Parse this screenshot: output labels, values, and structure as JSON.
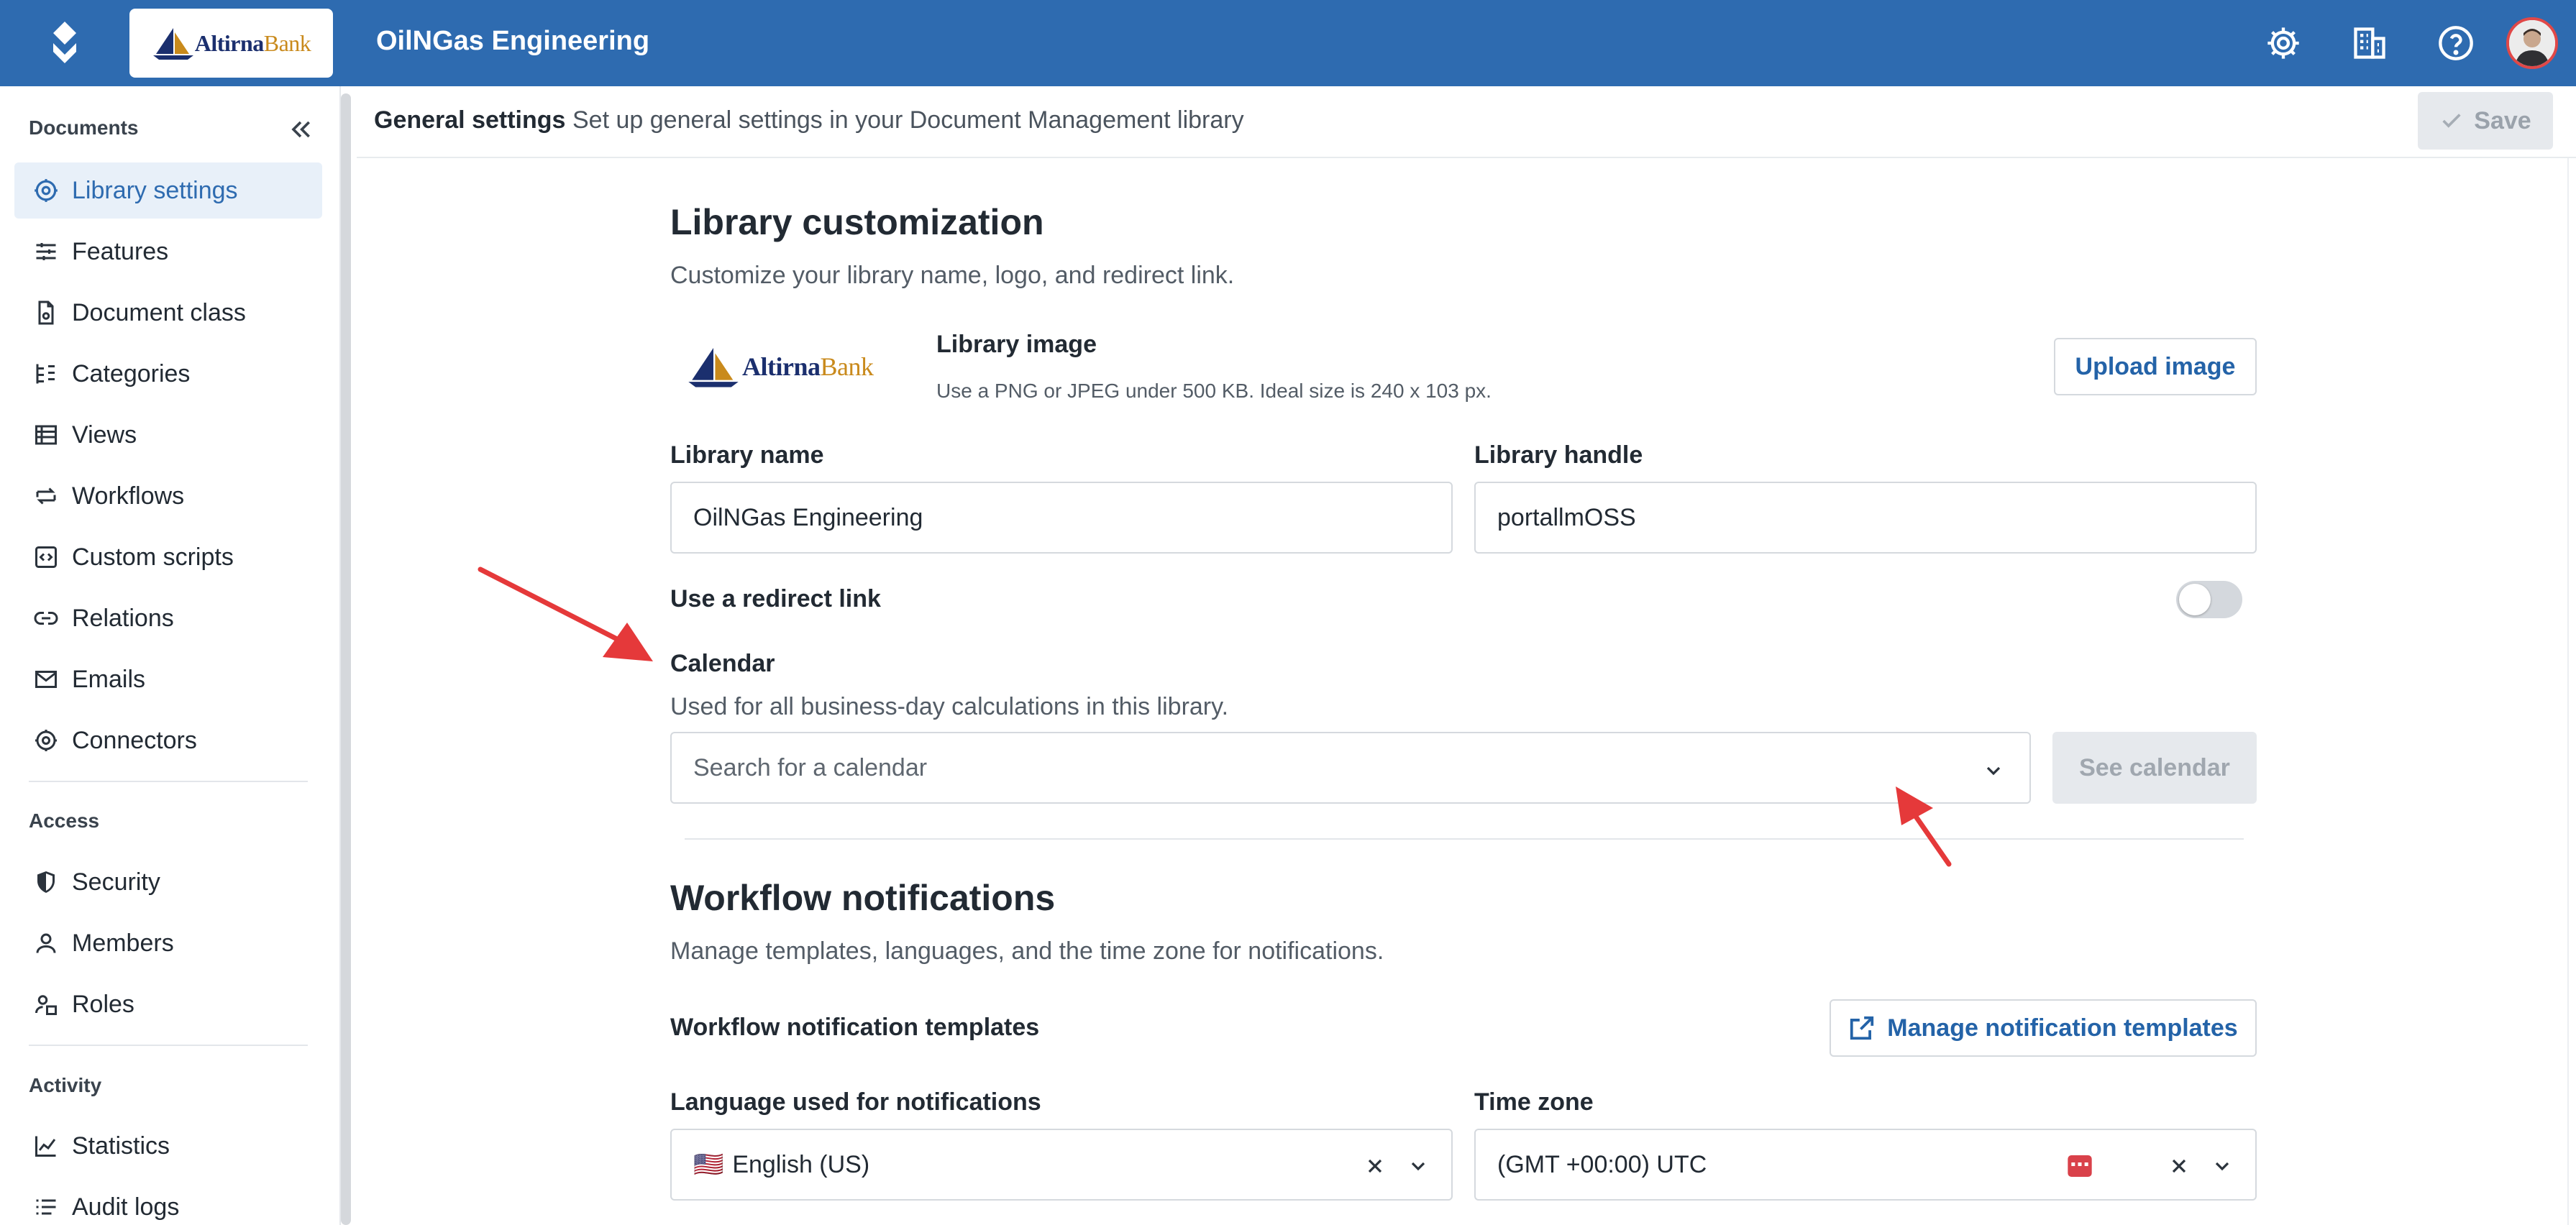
{
  "header": {
    "brand_part1": "Altirna",
    "brand_part2": "Bank",
    "title": "OilNGas Engineering",
    "icons": [
      "settings-icon",
      "building-icon",
      "help-icon"
    ]
  },
  "sidebar": {
    "sections": {
      "documents": "Documents",
      "access": "Access",
      "activity": "Activity"
    },
    "documents_items": [
      {
        "label": "Library settings",
        "icon": "gear-icon"
      },
      {
        "label": "Features",
        "icon": "sliders-icon"
      },
      {
        "label": "Document class",
        "icon": "file-gear-icon"
      },
      {
        "label": "Categories",
        "icon": "tree-icon"
      },
      {
        "label": "Views",
        "icon": "table-icon"
      },
      {
        "label": "Workflows",
        "icon": "loop-icon"
      },
      {
        "label": "Custom scripts",
        "icon": "code-icon"
      },
      {
        "label": "Relations",
        "icon": "link-icon"
      },
      {
        "label": "Emails",
        "icon": "mail-icon"
      },
      {
        "label": "Connectors",
        "icon": "gear-icon"
      }
    ],
    "access_items": [
      {
        "label": "Security",
        "icon": "shield-icon"
      },
      {
        "label": "Members",
        "icon": "person-icon"
      },
      {
        "label": "Roles",
        "icon": "roles-icon"
      }
    ],
    "activity_items": [
      {
        "label": "Statistics",
        "icon": "chart-icon"
      },
      {
        "label": "Audit logs",
        "icon": "list-icon"
      }
    ]
  },
  "settings_bar": {
    "title": "General settings",
    "subtitle": "Set up general settings in your Document Management library",
    "save_label": "Save"
  },
  "customization": {
    "heading": "Library customization",
    "description": "Customize your library name, logo, and redirect link.",
    "image_label": "Library image",
    "image_hint": "Use a PNG or JPEG under 500 KB. Ideal size is 240 x 103 px.",
    "upload_label": "Upload image",
    "name_label": "Library name",
    "name_value": "OilNGas Engineering",
    "handle_label": "Library handle",
    "handle_value": "portallmOSS",
    "redirect_label": "Use a redirect link",
    "redirect_enabled": false
  },
  "calendar": {
    "label": "Calendar",
    "description": "Used for all business-day calculations in this library.",
    "placeholder": "Search for a calendar",
    "see_calendar_label": "See calendar"
  },
  "notifications": {
    "heading": "Workflow notifications",
    "description": "Manage templates, languages, and the time zone for notifications.",
    "templates_label": "Workflow notification templates",
    "manage_label": "Manage notification templates",
    "language_label": "Language used for notifications",
    "language_flag": "🇺🇸",
    "language_value": "English (US)",
    "timezone_label": "Time zone",
    "timezone_value": "(GMT +00:00) UTC"
  },
  "colors": {
    "header_bg": "#2e6bb0",
    "accent": "#2463a8",
    "annotation_arrow": "#e5393a"
  }
}
